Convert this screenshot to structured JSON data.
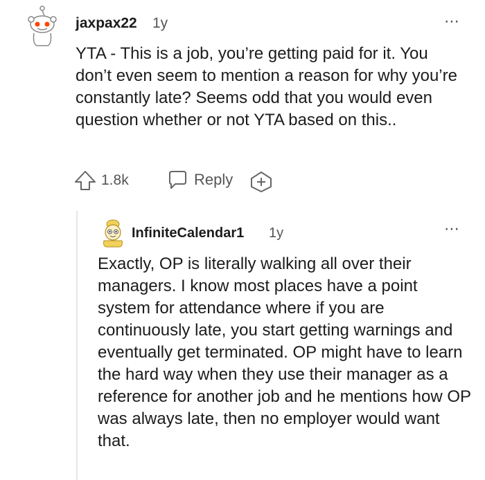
{
  "comment": {
    "author": "jaxpax22",
    "age": "1y",
    "more_icon": "⋯",
    "body": "YTA - This is a job, you’re getting paid for it. You don’t even seem to mention a reason for why you’re constantly late? Seems odd that you would even question whether or not YTA based on this..",
    "votes": "1.8k",
    "reply_label": "Reply"
  },
  "reply": {
    "author": "InfiniteCalendar1",
    "age": "1y",
    "more_icon": "⋯",
    "body": "Exactly, OP is literally walking all over their managers. I know most places have a point system for attendance where if you are continuously late, you start getting warnings and eventually get terminated. OP might have to learn the hard way when they use their manager as a reference for another job and he mentions how OP was always late, then no employer would want that."
  },
  "colors": {
    "text": "#1c1c1c",
    "muted": "#555555",
    "thread_line": "#e6e6e6",
    "avatar_red": "#ff4500"
  }
}
